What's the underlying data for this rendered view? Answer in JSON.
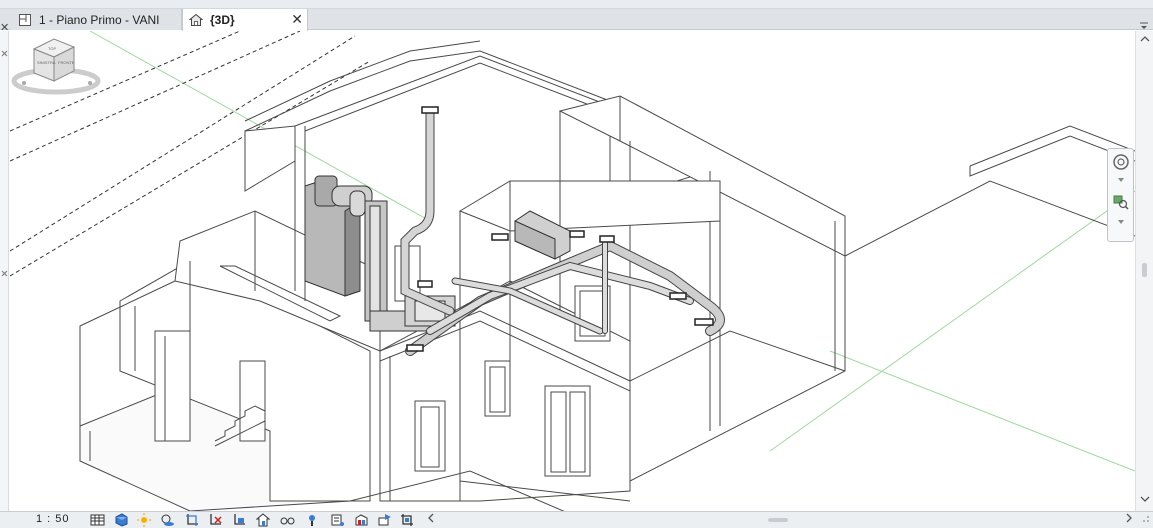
{
  "tabs": [
    {
      "label": "1 - Piano Primo - VANI",
      "icon": "floor-plan-icon",
      "active": false
    },
    {
      "label": "{3D}",
      "icon": "home-3d-icon",
      "active": true,
      "close": "✕"
    }
  ],
  "status": {
    "scale": "1 : 50",
    "tools": [
      "detail-level-icon",
      "visual-style-icon",
      "sun-path-icon",
      "shadows-icon",
      "crop-view-icon",
      "show-crop-region-icon",
      "unlock-3d-view-icon",
      "temporary-hide-icon",
      "reveal-hidden-icon",
      "temporary-view-properties-icon",
      "show-analytical-model-icon",
      "highlight-displacement-icon",
      "reveal-constraints-icon",
      "worksharing-display-icon",
      "render-icon"
    ]
  },
  "viewcube": {
    "faces": [
      "TOP",
      "SINISTRA",
      "FRONTE"
    ]
  },
  "navbar": {
    "tools": [
      "steering-wheel-icon",
      "zoom-icon"
    ]
  },
  "colors": {
    "tab_active_bg": "#ffffff",
    "tabbar_bg": "#dfe3e8",
    "model_line": "#5a5a5a",
    "grid_line": "#8fd08f",
    "duct_fill": "#bdbdbd"
  }
}
